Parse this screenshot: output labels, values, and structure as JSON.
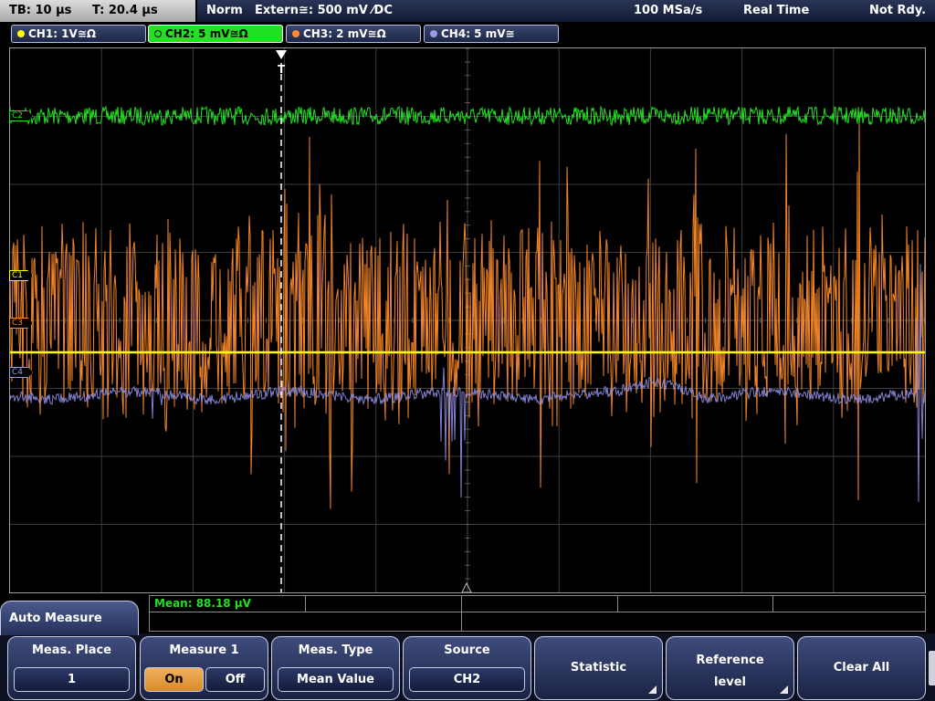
{
  "top_bar": {
    "timebase": "TB: 10 µs",
    "trigger_time": "T: 20.4 µs",
    "acq_mode": "Norm",
    "trigger": "Extern≅: 500 mV ⁄DC",
    "sample_rate": "100 MSa/s",
    "realtime": "Real Time",
    "status": "Not Rdy."
  },
  "channels": [
    {
      "label": "CH1: 1V≅Ω",
      "color": "#ffff00",
      "marker": "C1"
    },
    {
      "label": "CH2: 5 mV≅Ω",
      "color": "#22e022",
      "marker": "C2"
    },
    {
      "label": "CH3: 2 mV≅Ω",
      "color": "#ff8c2a",
      "marker": "C3"
    },
    {
      "label": "CH4: 5 mV≅",
      "color": "#9a9ae6",
      "marker": "C4"
    }
  ],
  "active_channel": "CH2",
  "measurement": {
    "result": "Mean: 88.18 µV"
  },
  "menu": {
    "title": "Auto Measure",
    "meas_place": {
      "title": "Meas. Place",
      "value": "1"
    },
    "measure1": {
      "title": "Measure 1",
      "on": "On",
      "off": "Off",
      "selected": "On"
    },
    "meas_type": {
      "title": "Meas. Type",
      "value": "Mean Value"
    },
    "source": {
      "title": "Source",
      "value": "CH2"
    },
    "statistic": {
      "title": "Statistic"
    },
    "reference_level": {
      "title_line1": "Reference",
      "title_line2": "level"
    },
    "clear_all": {
      "title": "Clear All"
    }
  },
  "colors": {
    "grid": "#3c3c3c",
    "trigger_line": "#ffffff"
  }
}
